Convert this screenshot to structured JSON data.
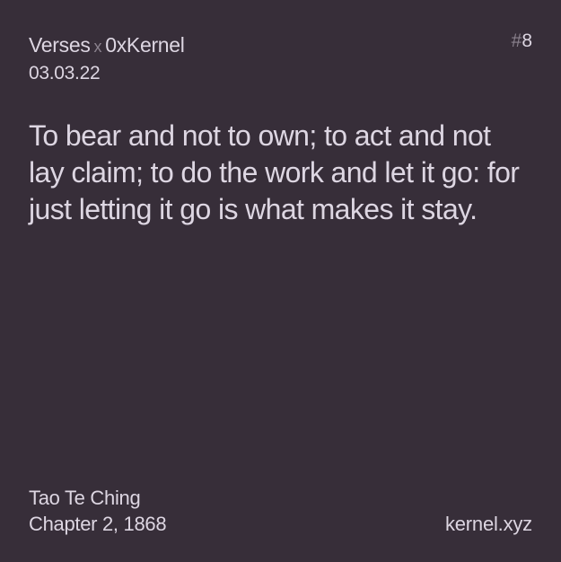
{
  "header": {
    "brand_left": "Verses",
    "brand_separator": "x",
    "brand_right": "0xKernel",
    "date": "03.03.22",
    "number_hash": "#",
    "number_value": "8"
  },
  "quote": {
    "text": "To bear and not to own; to act and not lay claim; to do the work and let it go: for just letting it go is what makes it stay."
  },
  "footer": {
    "source_title": "Tao Te Ching",
    "source_detail": "Chapter 2, 1868",
    "site": "kernel.xyz"
  },
  "colors": {
    "background": "#372e39",
    "text": "#ddd6e2",
    "muted": "#8b828e"
  }
}
